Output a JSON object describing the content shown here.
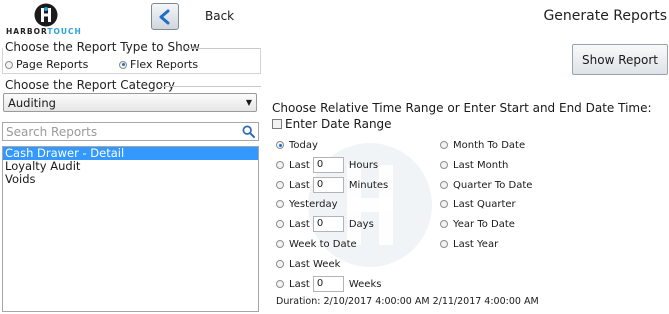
{
  "header": {
    "logo_text_dark": "HARBOR",
    "logo_text_accent": "TOUCH",
    "back_label": "Back",
    "title": "Generate Reports",
    "back_icon": "chevron-left-icon",
    "accent_color": "#2aa5d9"
  },
  "report_type": {
    "title": "Choose the Report Type to Show",
    "options": [
      {
        "label": "Page Reports",
        "checked": false
      },
      {
        "label": "Flex Reports",
        "checked": true
      }
    ]
  },
  "category": {
    "title": "Choose the Report Category",
    "selected": "Auditing"
  },
  "search": {
    "placeholder": "Search Reports",
    "icon": "search-icon"
  },
  "reports": {
    "items": [
      "Cash Drawer - Detail",
      "Loyalty Audit",
      "Voids"
    ],
    "selected_index": 0,
    "selected_color": "#3399ff"
  },
  "show_report_label": "Show Report",
  "time_range": {
    "title": "Choose Relative Time Range or Enter Start and End Date Time:",
    "enter_date_range_label": "Enter Date Range",
    "enter_date_range_checked": false,
    "left_options": [
      {
        "type": "plain",
        "label": "Today",
        "checked": true
      },
      {
        "type": "input",
        "prefix": "Last",
        "value": "0",
        "unit": "Hours",
        "checked": false
      },
      {
        "type": "input",
        "prefix": "Last",
        "value": "0",
        "unit": "Minutes",
        "checked": false
      },
      {
        "type": "plain",
        "label": "Yesterday",
        "checked": false
      },
      {
        "type": "input",
        "prefix": "Last",
        "value": "0",
        "unit": "Days",
        "checked": false
      },
      {
        "type": "plain",
        "label": "Week to Date",
        "checked": false
      },
      {
        "type": "plain",
        "label": "Last Week",
        "checked": false
      },
      {
        "type": "input",
        "prefix": "Last",
        "value": "0",
        "unit": "Weeks",
        "checked": false
      }
    ],
    "right_options": [
      {
        "label": "Month To Date",
        "checked": false
      },
      {
        "label": "Last Month",
        "checked": false
      },
      {
        "label": "Quarter To Date",
        "checked": false
      },
      {
        "label": "Last Quarter",
        "checked": false
      },
      {
        "label": "Year To Date",
        "checked": false
      },
      {
        "label": "Last Year",
        "checked": false
      }
    ],
    "duration": "Duration: 2/10/2017 4:00:00 AM 2/11/2017 4:00:00 AM"
  }
}
